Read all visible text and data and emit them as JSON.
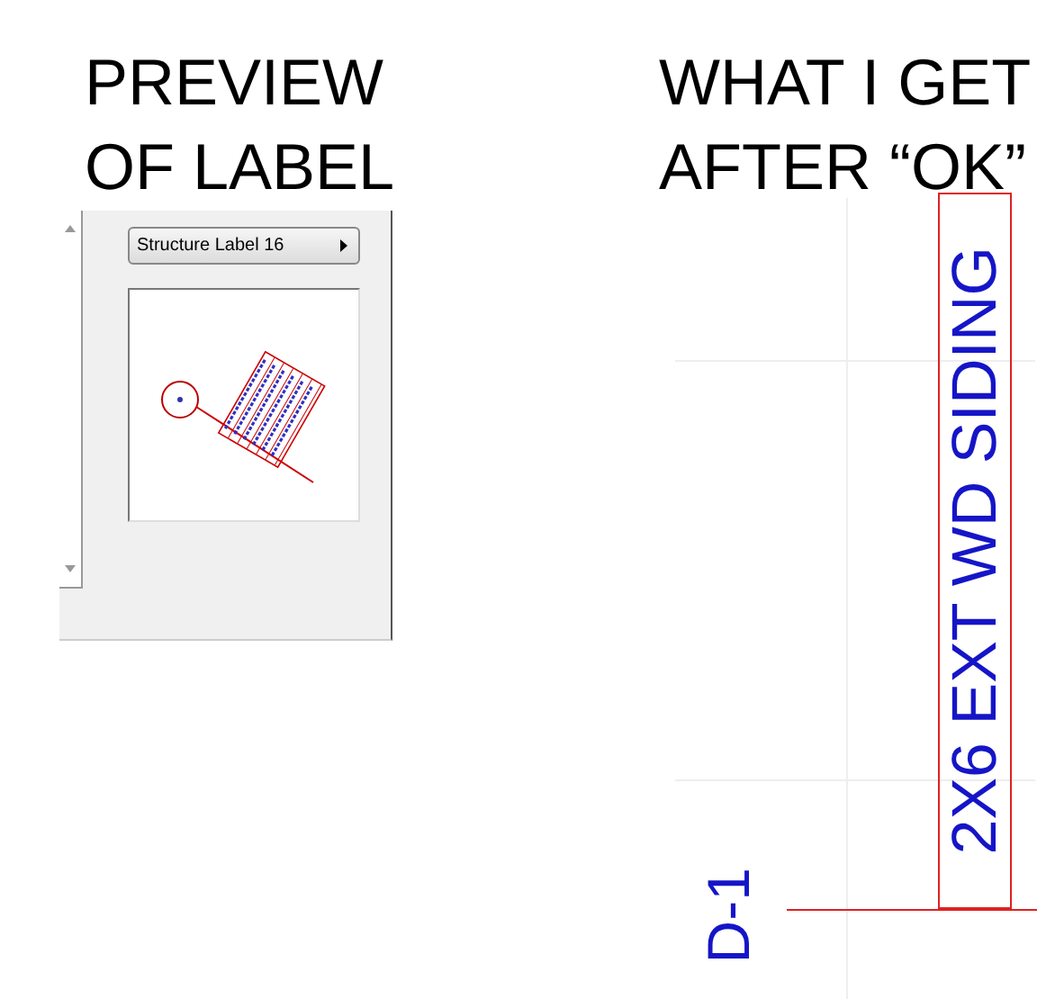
{
  "preview_heading": {
    "lines": [
      "PREVIEW",
      "OF LABEL"
    ]
  },
  "result_heading": {
    "lines": [
      "WHAT I  GET",
      "AFTER “OK”"
    ]
  },
  "label_dialog": {
    "style_dropdown": {
      "value": "Structure Label 16"
    }
  },
  "drawing": {
    "label_text": "2X6 EXT WD SIDING",
    "tag_text": "D-1"
  }
}
